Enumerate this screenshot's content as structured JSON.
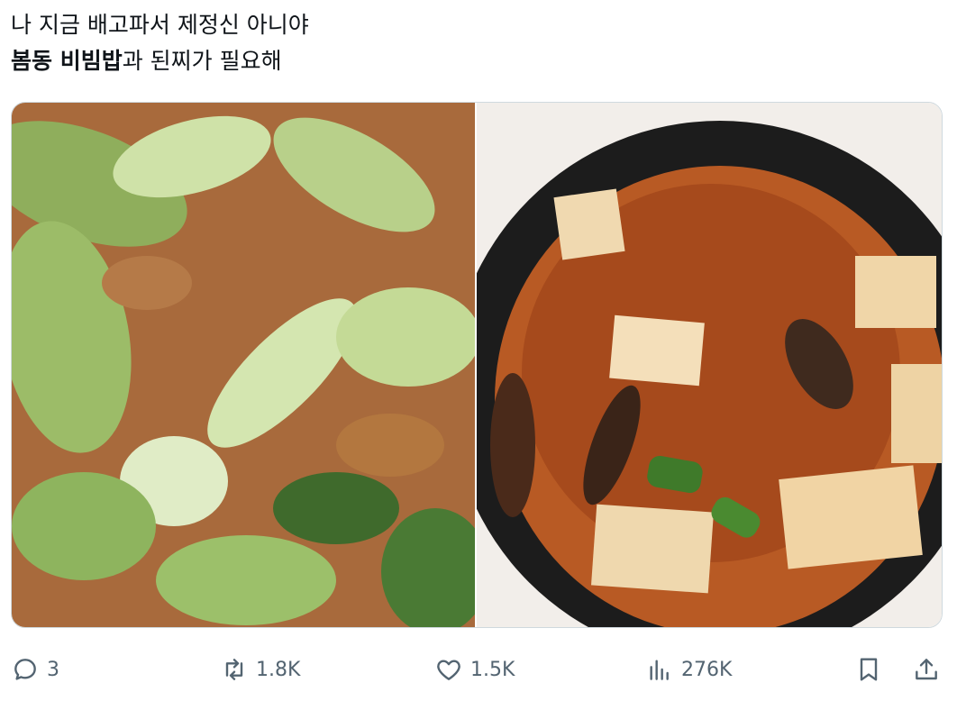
{
  "tweet": {
    "line1": "나 지금 배고파서 제정신 아니야",
    "line2_bold": "봄동 비빔밥",
    "line2_rest": "과 된찌가 필요해"
  },
  "media": {
    "left_icon": "photo-bibimbap",
    "right_icon": "photo-doenjang-jjigae"
  },
  "actions": {
    "reply_count": "3",
    "retweet_count": "1.8K",
    "like_count": "1.5K",
    "views_count": "276K",
    "icons": [
      "reply-icon",
      "retweet-icon",
      "like-icon",
      "views-icon",
      "bookmark-icon",
      "share-icon"
    ]
  },
  "colors": {
    "text": "#0f1419",
    "muted": "#536471",
    "border": "#cfd9de"
  }
}
